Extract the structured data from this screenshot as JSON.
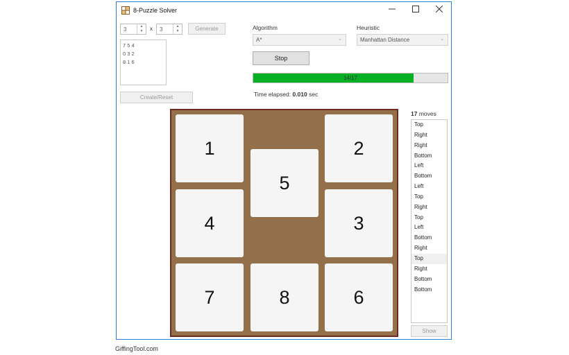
{
  "window": {
    "title": "8-Puzzle Solver"
  },
  "controls": {
    "rows": "3",
    "cols": "3",
    "times": "x",
    "generate_label": "Generate",
    "puzzle_text": [
      "7 5 4",
      "0 3 2",
      "8 1 6"
    ],
    "create_reset_label": "Create/Reset"
  },
  "algorithm": {
    "label": "Algorithm",
    "value": "A*"
  },
  "heuristic": {
    "label": "Heuristic",
    "value": "Manhattan Distance"
  },
  "stop_label": "Stop",
  "progress": {
    "text": "14/17",
    "fraction": 0.824
  },
  "elapsed": {
    "prefix": "Time elapsed:",
    "value": "0.010",
    "unit": "sec"
  },
  "board": {
    "tiles": [
      "1",
      "",
      "2",
      "4",
      "5",
      "3",
      "7",
      "8",
      "6"
    ]
  },
  "moves": {
    "count": "17",
    "label": "moves",
    "list": [
      "Top",
      "Right",
      "Right",
      "Bottom",
      "Left",
      "Bottom",
      "Left",
      "Top",
      "Right",
      "Top",
      "Left",
      "Bottom",
      "Right",
      "Top",
      "Right",
      "Bottom",
      "Bottom"
    ],
    "selected_index": 13,
    "show_label": "Show"
  },
  "footer": "GiffingTool.com",
  "colors": {
    "progress_fill": "#06b025",
    "board_bg": "#94704a",
    "board_border": "#6b2a22",
    "tile_bg": "#f5f5f5"
  },
  "icons": {
    "app": "puzzle-app-icon",
    "minimize": "minimize-icon",
    "maximize": "maximize-icon",
    "close": "close-icon"
  }
}
